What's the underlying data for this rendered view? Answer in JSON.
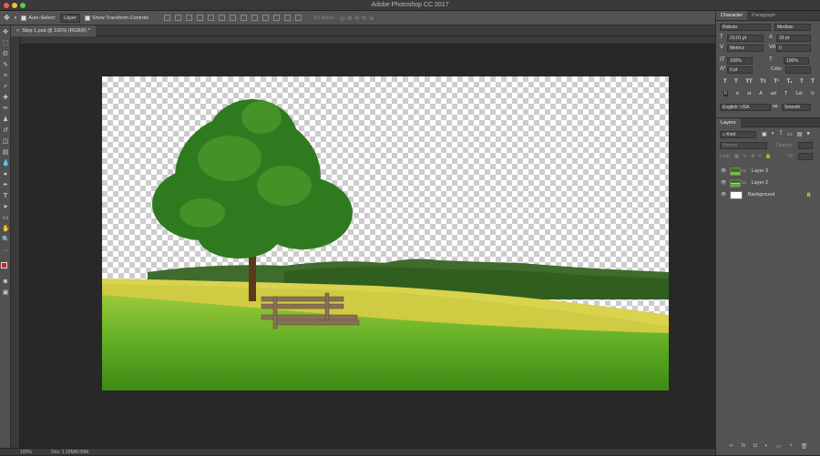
{
  "app": {
    "title": "Adobe Photoshop CC 2017"
  },
  "options_bar": {
    "auto_select_label": "Auto-Select:",
    "auto_select_value": "Layer",
    "transform_label": "Show Transform Controls",
    "mode_label": "3D Mode:"
  },
  "document": {
    "tab_title": "Step 1.psd @ 100% (RGB/8) *",
    "zoom": "100%",
    "doc_size": "Doc: 1.29M/6.00M"
  },
  "character_panel": {
    "tabs": [
      "Character",
      "Paragraph"
    ],
    "font_family": "Roboto",
    "font_style": "Medium",
    "font_size": "23.01 pt",
    "leading": "33 pt",
    "kerning": "Metrics",
    "tracking": "0",
    "vertical_scale": "100%",
    "horizontal_scale": "100%",
    "baseline_shift": "0 pt",
    "color_label": "Color:",
    "style_buttons": [
      "T",
      "T",
      "TT",
      "Tт",
      "T¹",
      "T₁",
      "T",
      "T"
    ],
    "feature_buttons": [
      "fi",
      "σ",
      "st",
      "A",
      "ad",
      "T",
      "1st",
      "½"
    ],
    "language": "English: USA",
    "antialias_label": "aa",
    "antialias_value": "Smooth"
  },
  "layers_panel": {
    "title": "Layers",
    "filter_kind": "Kind",
    "blend_mode": "Normal",
    "opacity_label": "Opacity:",
    "lock_label": "Lock:",
    "fill_label": "Fill:",
    "layers": [
      {
        "name": "Layer 3"
      },
      {
        "name": "Layer 2"
      },
      {
        "name": "Background"
      }
    ],
    "bottom_icons": [
      "∞",
      "fx",
      "◘",
      "◐",
      "▭",
      "+",
      "🗑"
    ]
  },
  "colors": {
    "foreground": "#cc1f1f",
    "background": "#ffffff"
  },
  "canvas_alt": "Tree and wooden bench on a grassy field with transparent sky"
}
